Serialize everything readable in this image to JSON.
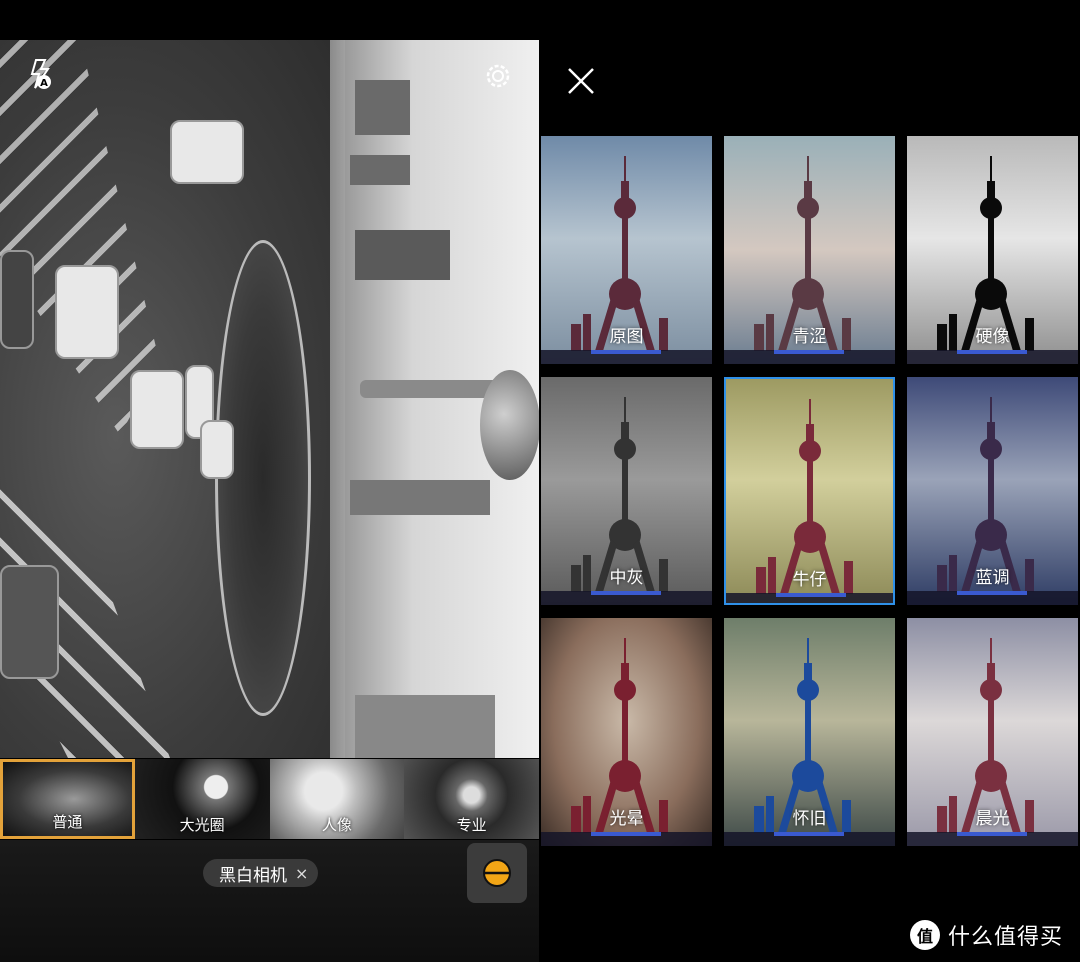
{
  "camera": {
    "modes": [
      {
        "label": "普通",
        "selected": true
      },
      {
        "label": "大光圈",
        "selected": false
      },
      {
        "label": "人像",
        "selected": false
      },
      {
        "label": "专业",
        "selected": false
      }
    ],
    "filter_chip": {
      "label": "黑白相机",
      "close_icon": "×"
    },
    "icons": {
      "flash": "flash-auto-icon",
      "settings": "gear-icon",
      "shutter": "filter-toggle-icon"
    },
    "accent_color": "#e3a23a"
  },
  "filters": {
    "close_icon": "close-icon",
    "items": [
      {
        "name": "原图",
        "tone": "original",
        "selected": false
      },
      {
        "name": "青涩",
        "tone": "tender",
        "selected": false
      },
      {
        "name": "硬像",
        "tone": "hard",
        "selected": false
      },
      {
        "name": "中灰",
        "tone": "grey",
        "selected": false
      },
      {
        "name": "牛仔",
        "tone": "denim",
        "selected": true
      },
      {
        "name": "蓝调",
        "tone": "blue",
        "selected": false
      },
      {
        "name": "光晕",
        "tone": "halo",
        "selected": false
      },
      {
        "name": "怀旧",
        "tone": "nostalgia",
        "selected": false
      },
      {
        "name": "晨光",
        "tone": "morning",
        "selected": false
      }
    ],
    "selected_color": "#2f90e8"
  },
  "watermark": {
    "mark": "值",
    "text": "什么值得买"
  }
}
